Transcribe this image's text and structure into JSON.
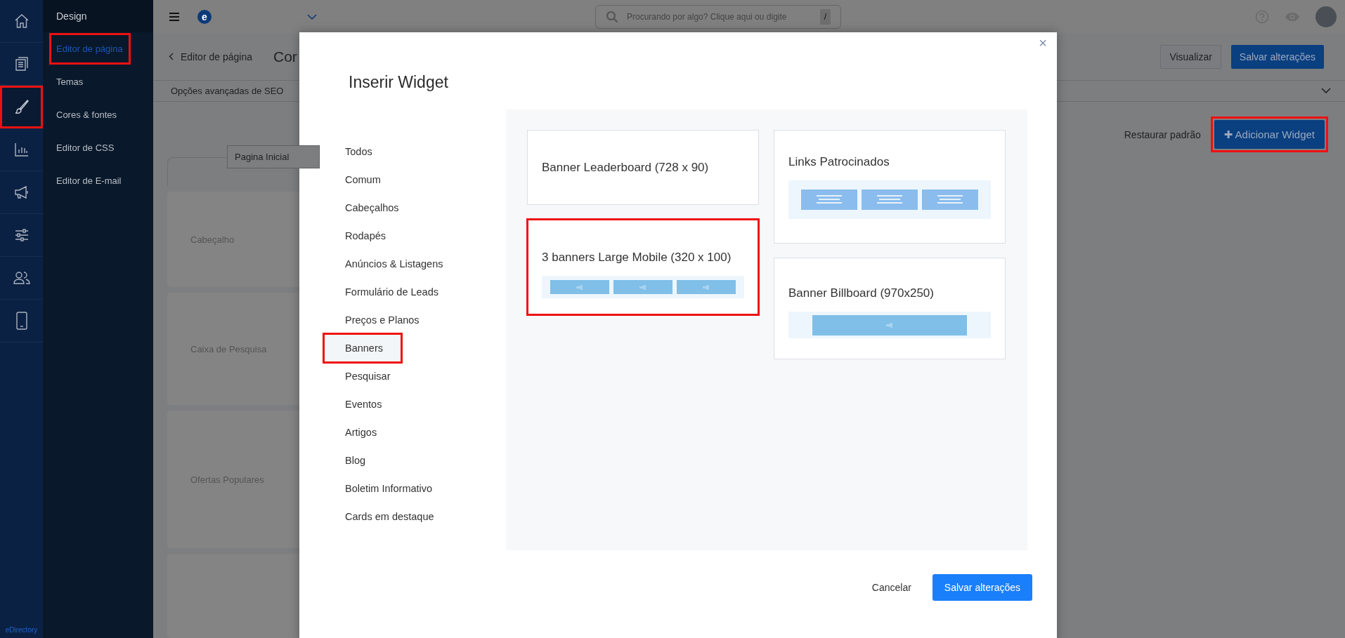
{
  "rail": {
    "items": [
      {
        "kind": "home",
        "selected": false,
        "highlighted": false
      },
      {
        "kind": "documents",
        "selected": false,
        "highlighted": false
      },
      {
        "kind": "brush",
        "selected": true,
        "highlighted": true
      },
      {
        "kind": "chart",
        "selected": false,
        "highlighted": false
      },
      {
        "kind": "megaphone",
        "selected": false,
        "highlighted": false
      },
      {
        "kind": "sliders",
        "selected": false,
        "highlighted": false
      },
      {
        "kind": "users",
        "selected": false,
        "highlighted": false
      },
      {
        "kind": "phone",
        "selected": false,
        "highlighted": false
      }
    ],
    "brand": "eDirectory"
  },
  "submenu": {
    "title": "Design",
    "items": [
      {
        "label": "Editor de página",
        "selected": true,
        "highlighted": true
      },
      {
        "label": "Temas",
        "selected": false,
        "highlighted": false
      },
      {
        "label": "Cores & fontes",
        "selected": false,
        "highlighted": false
      },
      {
        "label": "Editor de CSS",
        "selected": false,
        "highlighted": false
      },
      {
        "label": "Editor de E-mail",
        "selected": false,
        "highlighted": false
      }
    ]
  },
  "topbar": {
    "logo_letter": "e",
    "search": {
      "placeholder": "Procurando por algo? Clique aqui ou digite",
      "shortcut": "/"
    }
  },
  "page": {
    "breadcrumb": "Editor de página",
    "title": "Cor",
    "buttons": [
      {
        "label": "Visualizar",
        "kind": "secondary"
      },
      {
        "label": "Salvar alterações",
        "kind": "primary"
      }
    ],
    "seo_bar": "Opções avançadas de SEO",
    "restore": "Restaurar padrão",
    "add_widget": {
      "icon": "✚",
      "label": "Adicionar Widget",
      "highlighted": true
    },
    "page_tab": "Pagina Inicial",
    "sections": [
      "Cabeçalho",
      "Caixa de Pesquisa",
      "Ofertas Populares"
    ]
  },
  "modal": {
    "title": "Inserir Widget",
    "close": "×",
    "categories": [
      {
        "label": "Todos",
        "selected": false,
        "highlighted": false
      },
      {
        "label": "Comum",
        "selected": false,
        "highlighted": false
      },
      {
        "label": "Cabeçalhos",
        "selected": false,
        "highlighted": false
      },
      {
        "label": "Rodapés",
        "selected": false,
        "highlighted": false
      },
      {
        "label": "Anúncios & Listagens",
        "selected": false,
        "highlighted": false
      },
      {
        "label": "Formulário de Leads",
        "selected": false,
        "highlighted": false
      },
      {
        "label": "Preços e Planos",
        "selected": false,
        "highlighted": false
      },
      {
        "label": "Banners",
        "selected": true,
        "highlighted": true
      },
      {
        "label": "Pesquisar",
        "selected": false,
        "highlighted": false
      },
      {
        "label": "Eventos",
        "selected": false,
        "highlighted": false
      },
      {
        "label": "Artigos",
        "selected": false,
        "highlighted": false
      },
      {
        "label": "Blog",
        "selected": false,
        "highlighted": false
      },
      {
        "label": "Boletim Informativo",
        "selected": false,
        "highlighted": false
      },
      {
        "label": "Cards em destaque",
        "selected": false,
        "highlighted": false
      }
    ],
    "widget_columns": [
      {
        "cards": [
          {
            "title": "Banner Leaderboard (728 x 90)",
            "kind": "none",
            "highlighted": false
          },
          {
            "title": "3 banners Large Mobile (320 x 100)",
            "kind": "banners3",
            "highlighted": true
          }
        ]
      },
      {
        "cards": [
          {
            "title": "Links Patrocinados",
            "kind": "textblocks",
            "highlighted": false
          },
          {
            "title": "Banner Billboard (970x250)",
            "kind": "billboard",
            "highlighted": false
          }
        ]
      }
    ],
    "cancel": "Cancelar",
    "save": "Salvar alterações"
  }
}
